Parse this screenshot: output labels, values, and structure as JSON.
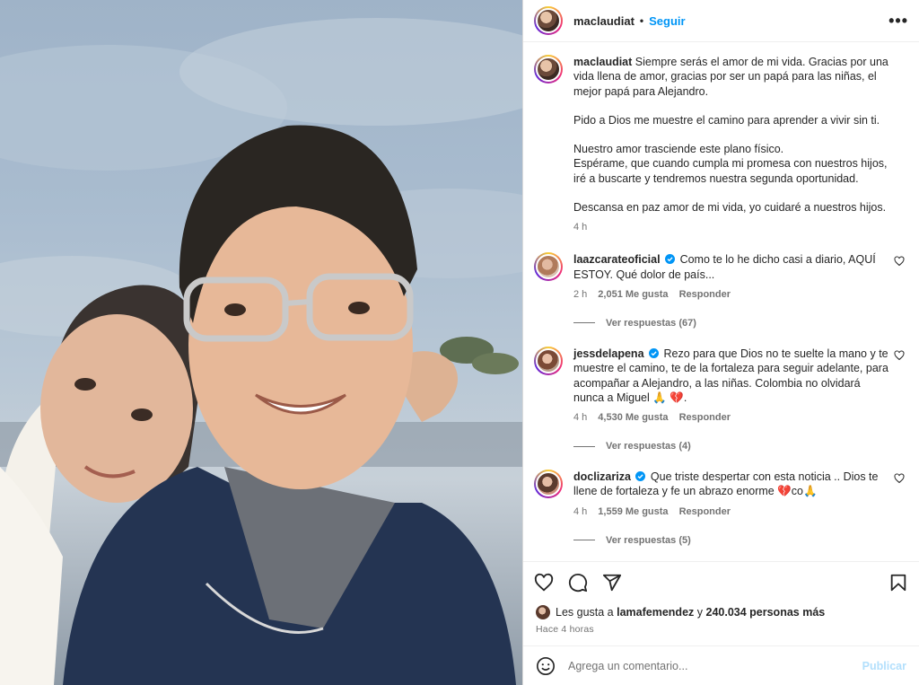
{
  "header": {
    "username": "maclaudiat",
    "separator": "•",
    "follow_label": "Seguir",
    "more_label": "•••"
  },
  "caption": {
    "username": "maclaudiat",
    "paragraphs": [
      "Siempre serás el amor de mi vida. Gracias por una vida llena de amor, gracias por ser un papá para las niñas, el mejor papá para Alejandro.",
      "Pido a Dios me muestre el camino para aprender a vivir sin ti.",
      "Nuestro amor trasciende este plano físico.",
      "Espérame, que cuando cumpla mi promesa con nuestros hijos, iré a buscarte y tendremos nuestra segunda oportunidad.",
      "Descansa en paz amor de mi vida, yo cuidaré a nuestros hijos."
    ],
    "time": "4 h"
  },
  "comments": [
    {
      "username": "laazcarateoficial",
      "verified": true,
      "text": "Como te lo he dicho casi a diario, AQUÍ ESTOY. Qué dolor de país...",
      "time": "2 h",
      "likes": "2,051 Me gusta",
      "reply_label": "Responder",
      "view_replies": "Ver respuestas (67)"
    },
    {
      "username": "jessdelapena",
      "verified": true,
      "text": "Rezo para que Dios no te suelte la mano y te muestre el camino, te de la fortaleza para seguir adelante, para acompañar a Alejandro, a las niñas. Colombia no olvidará nunca a Miguel 🙏 💔.",
      "time": "4 h",
      "likes": "4,530 Me gusta",
      "reply_label": "Responder",
      "view_replies": "Ver respuestas (4)"
    },
    {
      "username": "doclizariza",
      "verified": true,
      "text": "Que triste despertar con esta noticia .. Dios te llene de fortaleza y fe un abrazo enorme 💔co🙏",
      "time": "4 h",
      "likes": "1,559 Me gusta",
      "reply_label": "Responder",
      "view_replies": "Ver respuestas (5)"
    }
  ],
  "likes": {
    "prefix": "Les gusta a",
    "user": "lamafemendez",
    "conj": "y",
    "count": "240.034 personas más"
  },
  "timestamp": "Hace 4 horas",
  "comment_box": {
    "placeholder": "Agrega un comentario...",
    "post_label": "Publicar"
  },
  "colors": {
    "accent": "#0095f6",
    "verified": "#0095f6",
    "muted": "#737373",
    "post_disabled": "#b2dffc"
  }
}
